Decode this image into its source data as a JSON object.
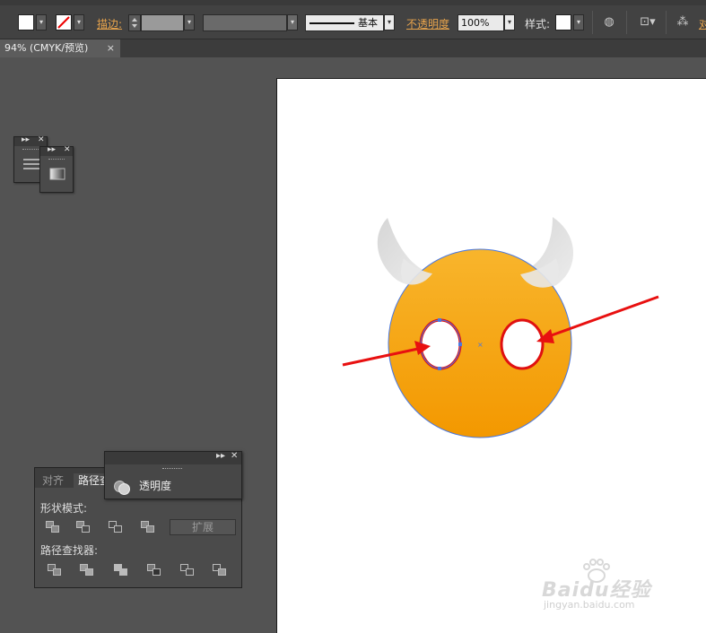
{
  "control_bar": {
    "stroke_label": "描边:",
    "brush_value": "基本",
    "opacity_label": "不透明度",
    "opacity_value": "100%",
    "style_label": "样式:",
    "cut_label": "对"
  },
  "document_tab": {
    "title": "94% (CMYK/预览)",
    "close": "×"
  },
  "mini_panels": {
    "collapse": "▸▸",
    "close": "✕"
  },
  "pathfinder_panel": {
    "tabs": [
      "对齐",
      "路径查"
    ],
    "shape_modes_label": "形状模式:",
    "pathfinders_label": "路径查找器:",
    "expand_label": "扩展"
  },
  "transparency_panel": {
    "label": "透明度",
    "collapse": "▸▸",
    "close": "✕"
  },
  "watermark": {
    "brand": "Baidu经验",
    "url": "jingyan.baidu.com"
  },
  "colors": {
    "face_top": "#f8b52c",
    "face_bottom": "#f39800",
    "annotation": "#e81010",
    "selection": "#4a78e0"
  }
}
